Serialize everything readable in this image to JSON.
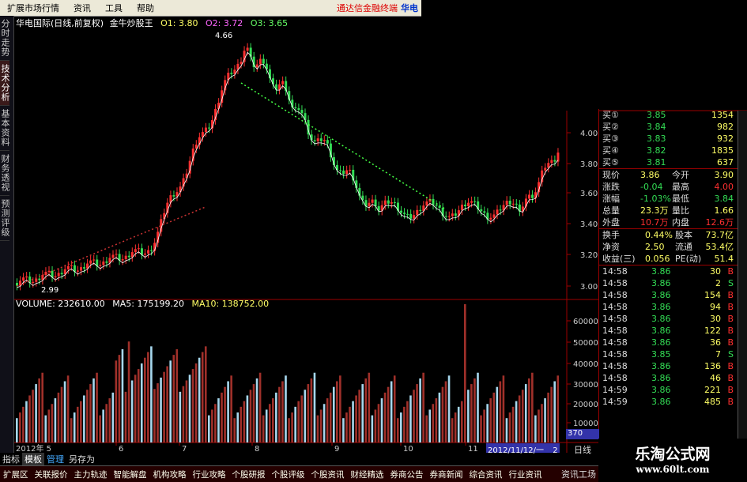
{
  "menubar": {
    "items": [
      "扩展市场行情",
      "资讯",
      "工具",
      "帮助"
    ],
    "ad": "通达信金融终端",
    "brand": "华电"
  },
  "left_tabs": [
    "分时走势",
    "技术分析",
    "基本资料",
    "财务透视",
    "预测评级"
  ],
  "chart_header": {
    "title": "华电国际(日线,前复权)",
    "indicator": "金牛炒股王",
    "o1": "O1: 3.80",
    "o2": "O2: 3.72",
    "o3": "O3: 3.65",
    "max_label": "4.66",
    "min_label": "2.99"
  },
  "volume_header": {
    "volume": "VOLUME: 232610.00",
    "ma5": "MA5: 175199.20",
    "ma10": "MA10: 138752.00"
  },
  "price_axis_labels": [
    "4.00",
    "3.80",
    "3.60",
    "3.40",
    "3.20",
    "3.00"
  ],
  "volume_axis_labels": [
    "60000",
    "50000",
    "40000",
    "30000",
    "20000",
    "10000"
  ],
  "x_axis_labels": [
    "2012年 5",
    "6",
    "7",
    "8",
    "9",
    "10",
    "11"
  ],
  "date_box": "2012/11/12/一",
  "date_box_suffix": "2",
  "vol_readout": "370",
  "right_label_top": "日线",
  "right_label_bottom": "资讯工场",
  "quote": {
    "asks": [
      {
        "label": "买①",
        "price": "3.85",
        "vol": "1354"
      },
      {
        "label": "买②",
        "price": "3.84",
        "vol": "982"
      },
      {
        "label": "买③",
        "price": "3.83",
        "vol": "932"
      },
      {
        "label": "买④",
        "price": "3.82",
        "vol": "1835"
      },
      {
        "label": "买⑤",
        "price": "3.81",
        "vol": "637"
      }
    ],
    "stats": [
      {
        "l1": "现价",
        "v1": "3.86",
        "l2": "今开",
        "v2": "3.90"
      },
      {
        "l1": "涨跌",
        "v1": "-0.04",
        "l2": "最高",
        "v2": "4.00"
      },
      {
        "l1": "涨幅",
        "v1": "-1.03%",
        "l2": "最低",
        "v2": "3.84"
      },
      {
        "l1": "总量",
        "v1": "23.3万",
        "l2": "量比",
        "v2": "1.66"
      },
      {
        "l1": "外盘",
        "v1": "10.7万",
        "l2": "内盘",
        "v2": "12.6万"
      }
    ],
    "fundamentals": [
      {
        "l1": "换手",
        "v1": "0.44%",
        "l2": "股本",
        "v2": "73.7亿"
      },
      {
        "l1": "净资",
        "v1": "2.50",
        "l2": "流通",
        "v2": "53.4亿"
      },
      {
        "l1": "收益(三)",
        "v1": "0.056",
        "l2": "PE(动)",
        "v2": "51.4"
      }
    ],
    "ticks": [
      {
        "time": "14:58",
        "price": "3.86",
        "vol": "30",
        "side": "B"
      },
      {
        "time": "14:58",
        "price": "3.86",
        "vol": "2",
        "side": "S"
      },
      {
        "time": "14:58",
        "price": "3.86",
        "vol": "154",
        "side": "B"
      },
      {
        "time": "14:58",
        "price": "3.86",
        "vol": "94",
        "side": "B"
      },
      {
        "time": "14:58",
        "price": "3.86",
        "vol": "30",
        "side": "B"
      },
      {
        "time": "14:58",
        "price": "3.86",
        "vol": "122",
        "side": "B"
      },
      {
        "time": "14:58",
        "price": "3.86",
        "vol": "36",
        "side": "B"
      },
      {
        "time": "14:58",
        "price": "3.85",
        "vol": "7",
        "side": "S"
      },
      {
        "time": "14:58",
        "price": "3.86",
        "vol": "136",
        "side": "B"
      },
      {
        "time": "14:58",
        "price": "3.86",
        "vol": "46",
        "side": "B"
      },
      {
        "time": "14:59",
        "price": "3.86",
        "vol": "221",
        "side": "B"
      },
      {
        "time": "14:59",
        "price": "3.86",
        "vol": "485",
        "side": "B"
      }
    ]
  },
  "bottom_tabs": [
    "指标",
    "模板",
    "管理",
    "另存为"
  ],
  "func_bar": [
    "扩展区",
    "关联报价",
    "主力轨迹",
    "智能解盘",
    "机构攻略",
    "行业攻略",
    "个股研报",
    "个股评级",
    "个股资讯",
    "财经精选",
    "券商公告",
    "券商新闻",
    "综合资讯",
    "行业资讯"
  ],
  "watermark": {
    "line1": "乐淘公式网",
    "line2": "www.60lt.com"
  },
  "colors": {
    "up": "#ff3030",
    "down": "#33dd55",
    "frame": "#9c0000",
    "label_ma": "#ffff66"
  }
}
